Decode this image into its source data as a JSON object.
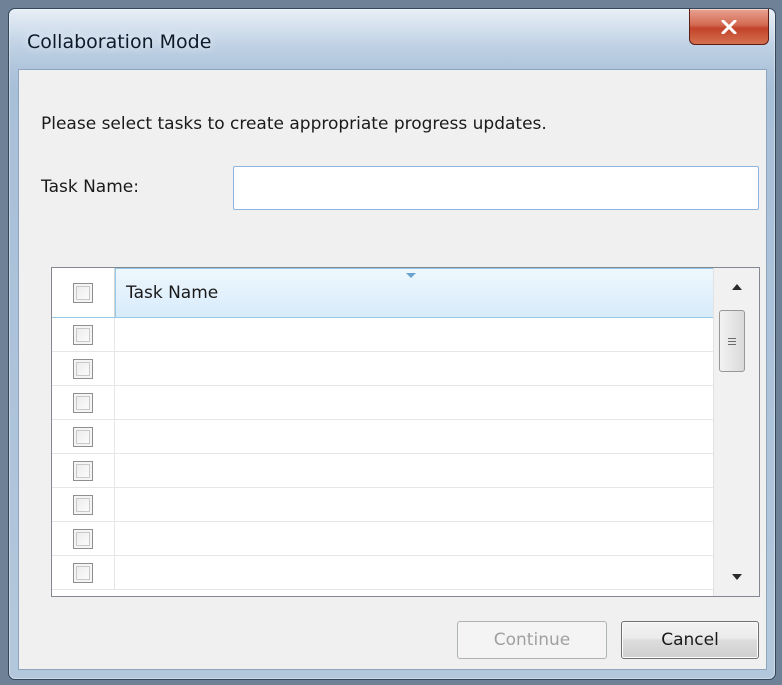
{
  "window": {
    "title": "Collaboration Mode",
    "close_icon": "close-icon"
  },
  "dialog": {
    "instruction": "Please select tasks to create appropriate progress updates.",
    "task_name_label": "Task Name:",
    "task_name_value": "",
    "task_name_placeholder": ""
  },
  "grid": {
    "columns": [
      "Task Name"
    ],
    "header_checkbox_checked": false,
    "rows": [
      {
        "checked": false,
        "task_name": ""
      },
      {
        "checked": false,
        "task_name": ""
      },
      {
        "checked": false,
        "task_name": ""
      },
      {
        "checked": false,
        "task_name": ""
      },
      {
        "checked": false,
        "task_name": ""
      },
      {
        "checked": false,
        "task_name": ""
      },
      {
        "checked": false,
        "task_name": ""
      },
      {
        "checked": false,
        "task_name": ""
      }
    ],
    "sort_indicator_icon": "sort-down-icon",
    "scrollbar": {
      "up_icon": "scroll-up-icon",
      "down_icon": "scroll-down-icon",
      "thumb_icon": "grip-icon"
    }
  },
  "buttons": {
    "continue_label": "Continue",
    "continue_enabled": false,
    "cancel_label": "Cancel"
  },
  "colors": {
    "header_accent": "#96c8e8",
    "close_button": "#c2432a"
  }
}
